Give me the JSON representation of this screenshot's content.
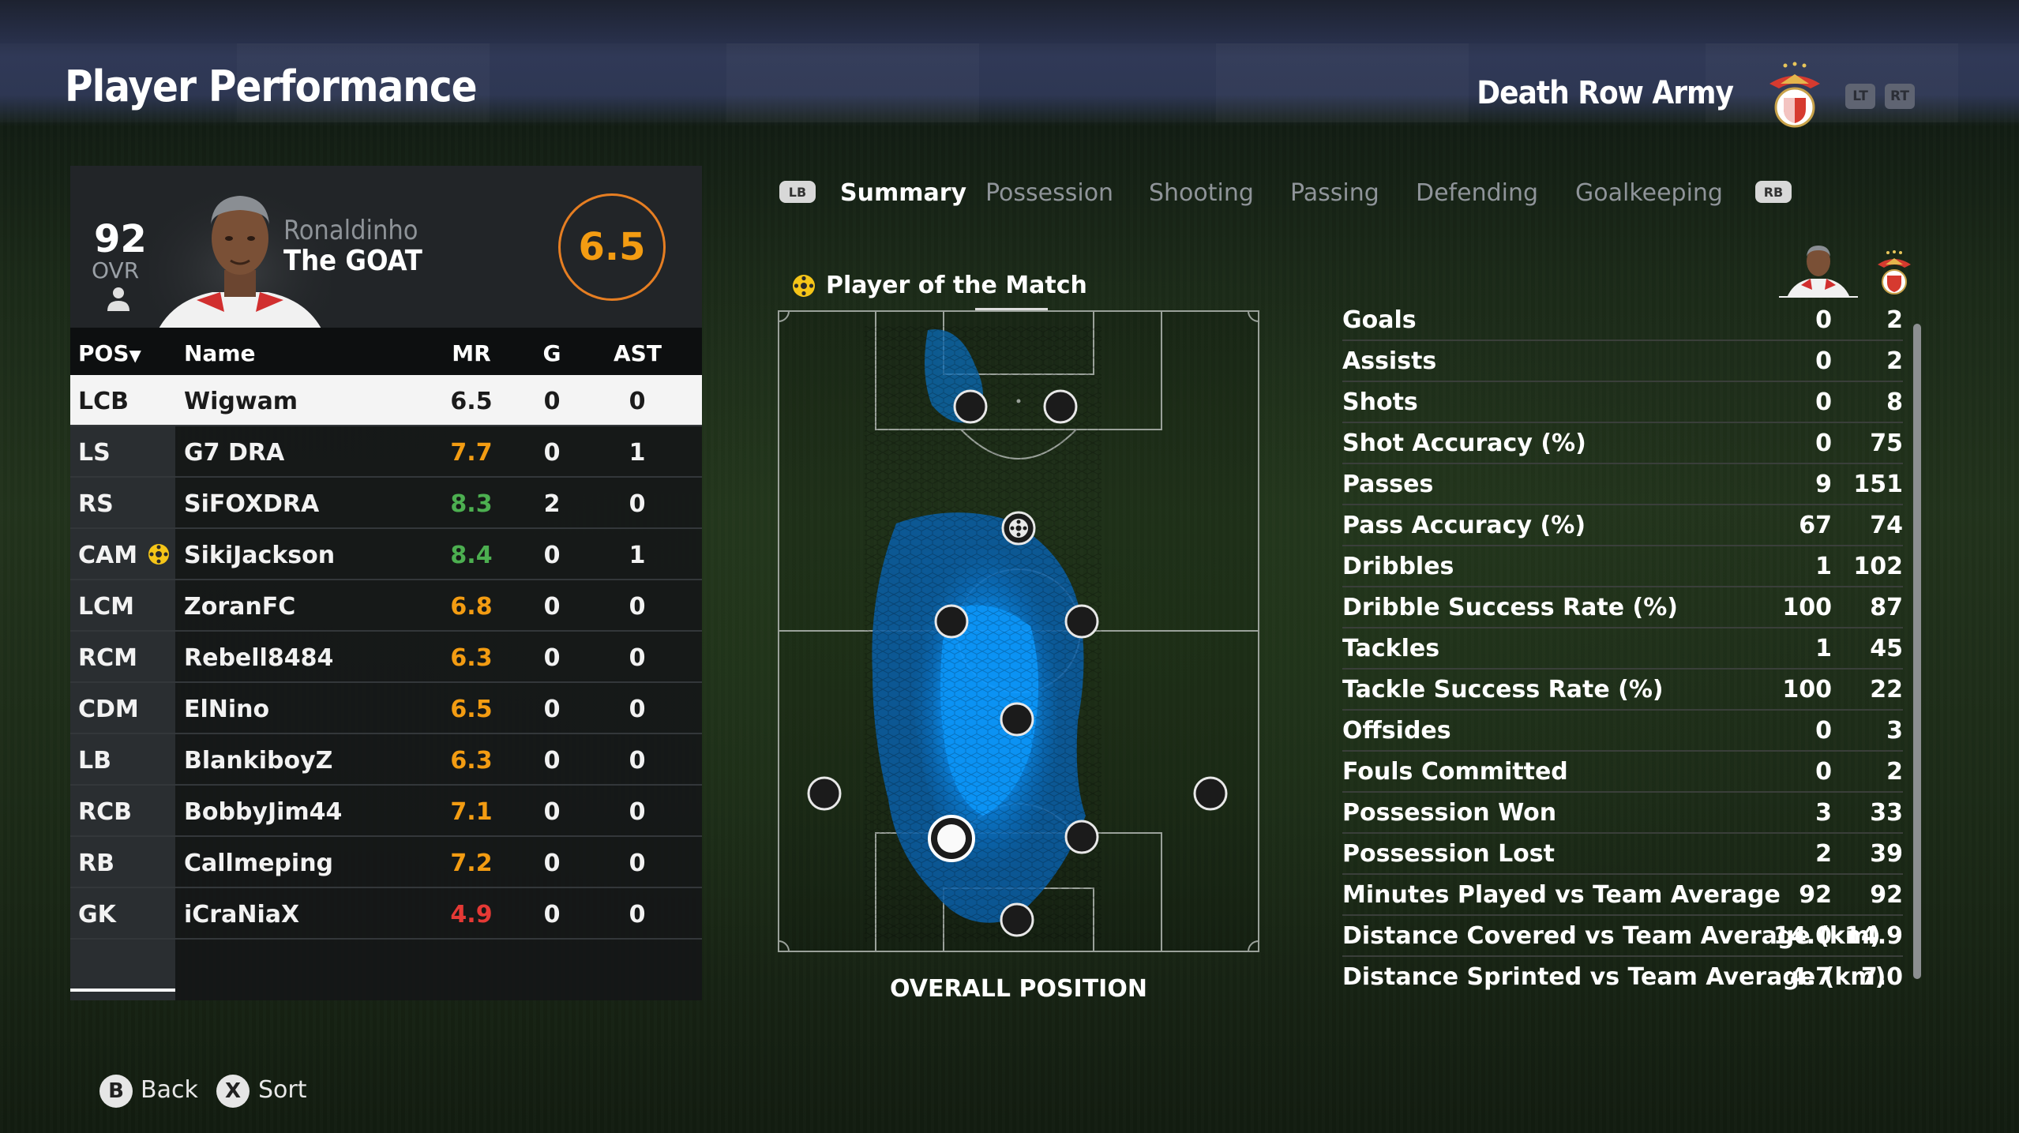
{
  "header": {
    "title": "Player Performance",
    "team_name": "Death Row Army",
    "lt_label": "LT",
    "rt_label": "RT"
  },
  "player_card": {
    "ovr": "92",
    "ovr_label": "OVR",
    "first_name": "Ronaldinho",
    "nickname": "The GOAT",
    "match_rating": "6.5"
  },
  "table": {
    "headers": {
      "pos": "POS",
      "name": "Name",
      "mr": "MR",
      "g": "G",
      "ast": "AST"
    },
    "rows": [
      {
        "pos": "LCB",
        "name": "Wigwam",
        "mr": "6.5",
        "g": "0",
        "ast": "0",
        "mr_color": "#1b1b1b"
      },
      {
        "pos": "LS",
        "name": "G7 DRA",
        "mr": "7.7",
        "g": "0",
        "ast": "1",
        "mr_color": "#f39c12"
      },
      {
        "pos": "RS",
        "name": "SiFOXDRA",
        "mr": "8.3",
        "g": "2",
        "ast": "0",
        "mr_color": "#4caf50"
      },
      {
        "pos": "CAM",
        "name": "SikiJackson",
        "mr": "8.4",
        "g": "0",
        "ast": "1",
        "mr_color": "#4caf50"
      },
      {
        "pos": "LCM",
        "name": "ZoranFC",
        "mr": "6.8",
        "g": "0",
        "ast": "0",
        "mr_color": "#f39c12"
      },
      {
        "pos": "RCM",
        "name": "Rebell8484",
        "mr": "6.3",
        "g": "0",
        "ast": "0",
        "mr_color": "#f39c12"
      },
      {
        "pos": "CDM",
        "name": "ElNino",
        "mr": "6.5",
        "g": "0",
        "ast": "0",
        "mr_color": "#f39c12"
      },
      {
        "pos": "LB",
        "name": "BlankiboyZ",
        "mr": "6.3",
        "g": "0",
        "ast": "0",
        "mr_color": "#f39c12"
      },
      {
        "pos": "RCB",
        "name": "BobbyJim44",
        "mr": "7.1",
        "g": "0",
        "ast": "0",
        "mr_color": "#f39c12"
      },
      {
        "pos": "RB",
        "name": "Callmeping",
        "mr": "7.2",
        "g": "0",
        "ast": "0",
        "mr_color": "#f39c12"
      },
      {
        "pos": "GK",
        "name": "iCraNiaX",
        "mr": "4.9",
        "g": "0",
        "ast": "0",
        "mr_color": "#e53935"
      }
    ]
  },
  "tabs": {
    "lb": "LB",
    "rb": "RB",
    "items": [
      "Summary",
      "Possession",
      "Shooting",
      "Passing",
      "Defending",
      "Goalkeeping"
    ],
    "active": "Summary"
  },
  "motm_label": "Player of the Match",
  "pitch_caption": "OVERALL POSITION",
  "stats": [
    {
      "label": "Goals",
      "player": "0",
      "team": "2"
    },
    {
      "label": "Assists",
      "player": "0",
      "team": "2"
    },
    {
      "label": "Shots",
      "player": "0",
      "team": "8"
    },
    {
      "label": "Shot Accuracy (%)",
      "player": "0",
      "team": "75"
    },
    {
      "label": "Passes",
      "player": "9",
      "team": "151"
    },
    {
      "label": "Pass Accuracy (%)",
      "player": "67",
      "team": "74"
    },
    {
      "label": "Dribbles",
      "player": "1",
      "team": "102"
    },
    {
      "label": "Dribble Success Rate (%)",
      "player": "100",
      "team": "87"
    },
    {
      "label": "Tackles",
      "player": "1",
      "team": "45"
    },
    {
      "label": "Tackle Success Rate (%)",
      "player": "100",
      "team": "22"
    },
    {
      "label": "Offsides",
      "player": "0",
      "team": "3"
    },
    {
      "label": "Fouls Committed",
      "player": "0",
      "team": "2"
    },
    {
      "label": "Possession Won",
      "player": "3",
      "team": "33"
    },
    {
      "label": "Possession Lost",
      "player": "2",
      "team": "39"
    },
    {
      "label": "Minutes Played vs Team Average",
      "player": "92",
      "team": "92"
    },
    {
      "label": "Distance Covered vs Team Average (km)",
      "player": "14.0",
      "team": "14.9"
    },
    {
      "label": "Distance Sprinted vs Team Average (km)",
      "player": "4.7",
      "team": "7.0"
    }
  ],
  "footer": {
    "back_key": "B",
    "back_label": "Back",
    "sort_key": "X",
    "sort_label": "Sort"
  },
  "colors": {
    "accent_orange": "#f39c12",
    "good_green": "#4caf50",
    "bad_red": "#e53935",
    "heat_blue": "#0a8cf0"
  }
}
